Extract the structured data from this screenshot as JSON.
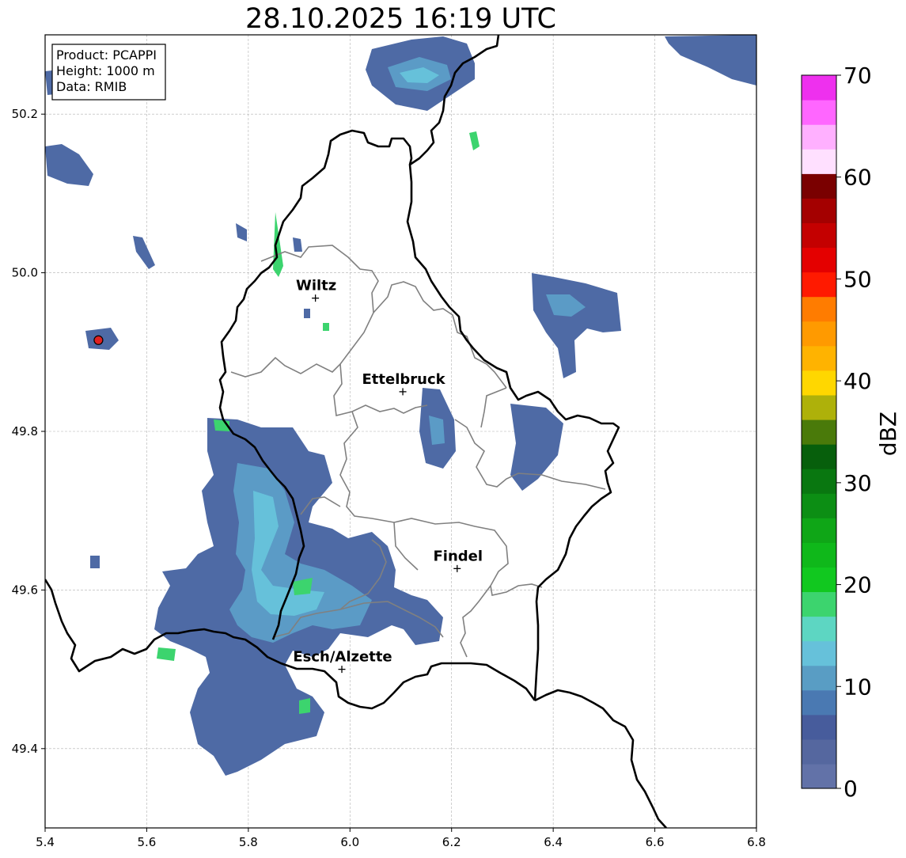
{
  "title": "28.10.2025 16:19 UTC",
  "info": {
    "product": "Product: PCAPPI",
    "height": "Height: 1000 m",
    "data": "Data: RMIB"
  },
  "map": {
    "lon_range": [
      5.4,
      6.8
    ],
    "lat_range": [
      49.3,
      50.3
    ],
    "x_ticks": [
      "5.4",
      "5.6",
      "5.8",
      "6.0",
      "6.2",
      "6.4",
      "6.6",
      "6.8"
    ],
    "y_ticks": [
      "49.4",
      "49.6",
      "49.8",
      "50.0",
      "50.2"
    ],
    "grid": true,
    "radar_site": {
      "lon": 5.505,
      "lat": 49.915,
      "color": "#e02020"
    },
    "cities": [
      {
        "name": "Wiltz",
        "lon": 5.932,
        "lat": 49.968
      },
      {
        "name": "Ettelbruck",
        "lon": 6.104,
        "lat": 49.85
      },
      {
        "name": "Findel",
        "lon": 6.211,
        "lat": 49.627
      },
      {
        "name": "Esch/Alzette",
        "lon": 5.984,
        "lat": 49.5
      }
    ]
  },
  "colorbar": {
    "label": "dBZ",
    "ticks": [
      "0",
      "10",
      "20",
      "30",
      "40",
      "50",
      "60",
      "70"
    ],
    "colors": [
      "#6272a8",
      "#55679f",
      "#475c9c",
      "#4a79b2",
      "#599dc4",
      "#66c1da",
      "#5dd6c2",
      "#3cd46e",
      "#11c81f",
      "#0fb81a",
      "#0fa617",
      "#0c8e14",
      "#097710",
      "#075f0c",
      "#4a7a0a",
      "#aeb10a",
      "#ffd700",
      "#ffb300",
      "#ff9a00",
      "#ff7c00",
      "#ff1a00",
      "#e40000",
      "#c40000",
      "#a40000",
      "#7a0000",
      "#ffe0ff",
      "#ffb0ff",
      "#ff66ff",
      "#ee30ee"
    ]
  }
}
